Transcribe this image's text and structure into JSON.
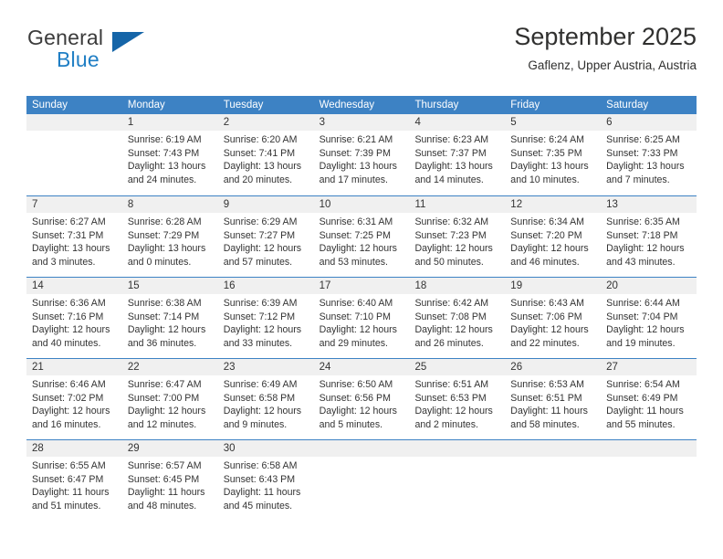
{
  "brand": {
    "word1": "General",
    "word2": "Blue",
    "triangle_icon": "triangle-icon",
    "color_blue": "#1f7ec4",
    "color_triangle": "#1565a8"
  },
  "header": {
    "title": "September 2025",
    "subtitle": "Gaflenz, Upper Austria, Austria"
  },
  "calendar": {
    "accent_color": "#3d82c4",
    "daynum_bg": "#f0f0f0",
    "weekdays": [
      "Sunday",
      "Monday",
      "Tuesday",
      "Wednesday",
      "Thursday",
      "Friday",
      "Saturday"
    ],
    "weeks": [
      [
        {
          "day": "",
          "sunrise": "",
          "sunset": "",
          "daylight_line1": "",
          "daylight_line2": "",
          "empty": true
        },
        {
          "day": "1",
          "sunrise": "Sunrise: 6:19 AM",
          "sunset": "Sunset: 7:43 PM",
          "daylight_line1": "Daylight: 13 hours",
          "daylight_line2": "and 24 minutes."
        },
        {
          "day": "2",
          "sunrise": "Sunrise: 6:20 AM",
          "sunset": "Sunset: 7:41 PM",
          "daylight_line1": "Daylight: 13 hours",
          "daylight_line2": "and 20 minutes."
        },
        {
          "day": "3",
          "sunrise": "Sunrise: 6:21 AM",
          "sunset": "Sunset: 7:39 PM",
          "daylight_line1": "Daylight: 13 hours",
          "daylight_line2": "and 17 minutes."
        },
        {
          "day": "4",
          "sunrise": "Sunrise: 6:23 AM",
          "sunset": "Sunset: 7:37 PM",
          "daylight_line1": "Daylight: 13 hours",
          "daylight_line2": "and 14 minutes."
        },
        {
          "day": "5",
          "sunrise": "Sunrise: 6:24 AM",
          "sunset": "Sunset: 7:35 PM",
          "daylight_line1": "Daylight: 13 hours",
          "daylight_line2": "and 10 minutes."
        },
        {
          "day": "6",
          "sunrise": "Sunrise: 6:25 AM",
          "sunset": "Sunset: 7:33 PM",
          "daylight_line1": "Daylight: 13 hours",
          "daylight_line2": "and 7 minutes."
        }
      ],
      [
        {
          "day": "7",
          "sunrise": "Sunrise: 6:27 AM",
          "sunset": "Sunset: 7:31 PM",
          "daylight_line1": "Daylight: 13 hours",
          "daylight_line2": "and 3 minutes."
        },
        {
          "day": "8",
          "sunrise": "Sunrise: 6:28 AM",
          "sunset": "Sunset: 7:29 PM",
          "daylight_line1": "Daylight: 13 hours",
          "daylight_line2": "and 0 minutes."
        },
        {
          "day": "9",
          "sunrise": "Sunrise: 6:29 AM",
          "sunset": "Sunset: 7:27 PM",
          "daylight_line1": "Daylight: 12 hours",
          "daylight_line2": "and 57 minutes."
        },
        {
          "day": "10",
          "sunrise": "Sunrise: 6:31 AM",
          "sunset": "Sunset: 7:25 PM",
          "daylight_line1": "Daylight: 12 hours",
          "daylight_line2": "and 53 minutes."
        },
        {
          "day": "11",
          "sunrise": "Sunrise: 6:32 AM",
          "sunset": "Sunset: 7:23 PM",
          "daylight_line1": "Daylight: 12 hours",
          "daylight_line2": "and 50 minutes."
        },
        {
          "day": "12",
          "sunrise": "Sunrise: 6:34 AM",
          "sunset": "Sunset: 7:20 PM",
          "daylight_line1": "Daylight: 12 hours",
          "daylight_line2": "and 46 minutes."
        },
        {
          "day": "13",
          "sunrise": "Sunrise: 6:35 AM",
          "sunset": "Sunset: 7:18 PM",
          "daylight_line1": "Daylight: 12 hours",
          "daylight_line2": "and 43 minutes."
        }
      ],
      [
        {
          "day": "14",
          "sunrise": "Sunrise: 6:36 AM",
          "sunset": "Sunset: 7:16 PM",
          "daylight_line1": "Daylight: 12 hours",
          "daylight_line2": "and 40 minutes."
        },
        {
          "day": "15",
          "sunrise": "Sunrise: 6:38 AM",
          "sunset": "Sunset: 7:14 PM",
          "daylight_line1": "Daylight: 12 hours",
          "daylight_line2": "and 36 minutes."
        },
        {
          "day": "16",
          "sunrise": "Sunrise: 6:39 AM",
          "sunset": "Sunset: 7:12 PM",
          "daylight_line1": "Daylight: 12 hours",
          "daylight_line2": "and 33 minutes."
        },
        {
          "day": "17",
          "sunrise": "Sunrise: 6:40 AM",
          "sunset": "Sunset: 7:10 PM",
          "daylight_line1": "Daylight: 12 hours",
          "daylight_line2": "and 29 minutes."
        },
        {
          "day": "18",
          "sunrise": "Sunrise: 6:42 AM",
          "sunset": "Sunset: 7:08 PM",
          "daylight_line1": "Daylight: 12 hours",
          "daylight_line2": "and 26 minutes."
        },
        {
          "day": "19",
          "sunrise": "Sunrise: 6:43 AM",
          "sunset": "Sunset: 7:06 PM",
          "daylight_line1": "Daylight: 12 hours",
          "daylight_line2": "and 22 minutes."
        },
        {
          "day": "20",
          "sunrise": "Sunrise: 6:44 AM",
          "sunset": "Sunset: 7:04 PM",
          "daylight_line1": "Daylight: 12 hours",
          "daylight_line2": "and 19 minutes."
        }
      ],
      [
        {
          "day": "21",
          "sunrise": "Sunrise: 6:46 AM",
          "sunset": "Sunset: 7:02 PM",
          "daylight_line1": "Daylight: 12 hours",
          "daylight_line2": "and 16 minutes."
        },
        {
          "day": "22",
          "sunrise": "Sunrise: 6:47 AM",
          "sunset": "Sunset: 7:00 PM",
          "daylight_line1": "Daylight: 12 hours",
          "daylight_line2": "and 12 minutes."
        },
        {
          "day": "23",
          "sunrise": "Sunrise: 6:49 AM",
          "sunset": "Sunset: 6:58 PM",
          "daylight_line1": "Daylight: 12 hours",
          "daylight_line2": "and 9 minutes."
        },
        {
          "day": "24",
          "sunrise": "Sunrise: 6:50 AM",
          "sunset": "Sunset: 6:56 PM",
          "daylight_line1": "Daylight: 12 hours",
          "daylight_line2": "and 5 minutes."
        },
        {
          "day": "25",
          "sunrise": "Sunrise: 6:51 AM",
          "sunset": "Sunset: 6:53 PM",
          "daylight_line1": "Daylight: 12 hours",
          "daylight_line2": "and 2 minutes."
        },
        {
          "day": "26",
          "sunrise": "Sunrise: 6:53 AM",
          "sunset": "Sunset: 6:51 PM",
          "daylight_line1": "Daylight: 11 hours",
          "daylight_line2": "and 58 minutes."
        },
        {
          "day": "27",
          "sunrise": "Sunrise: 6:54 AM",
          "sunset": "Sunset: 6:49 PM",
          "daylight_line1": "Daylight: 11 hours",
          "daylight_line2": "and 55 minutes."
        }
      ],
      [
        {
          "day": "28",
          "sunrise": "Sunrise: 6:55 AM",
          "sunset": "Sunset: 6:47 PM",
          "daylight_line1": "Daylight: 11 hours",
          "daylight_line2": "and 51 minutes."
        },
        {
          "day": "29",
          "sunrise": "Sunrise: 6:57 AM",
          "sunset": "Sunset: 6:45 PM",
          "daylight_line1": "Daylight: 11 hours",
          "daylight_line2": "and 48 minutes."
        },
        {
          "day": "30",
          "sunrise": "Sunrise: 6:58 AM",
          "sunset": "Sunset: 6:43 PM",
          "daylight_line1": "Daylight: 11 hours",
          "daylight_line2": "and 45 minutes."
        },
        {
          "day": "",
          "sunrise": "",
          "sunset": "",
          "daylight_line1": "",
          "daylight_line2": "",
          "empty": true
        },
        {
          "day": "",
          "sunrise": "",
          "sunset": "",
          "daylight_line1": "",
          "daylight_line2": "",
          "empty": true
        },
        {
          "day": "",
          "sunrise": "",
          "sunset": "",
          "daylight_line1": "",
          "daylight_line2": "",
          "empty": true
        },
        {
          "day": "",
          "sunrise": "",
          "sunset": "",
          "daylight_line1": "",
          "daylight_line2": "",
          "empty": true
        }
      ]
    ]
  }
}
